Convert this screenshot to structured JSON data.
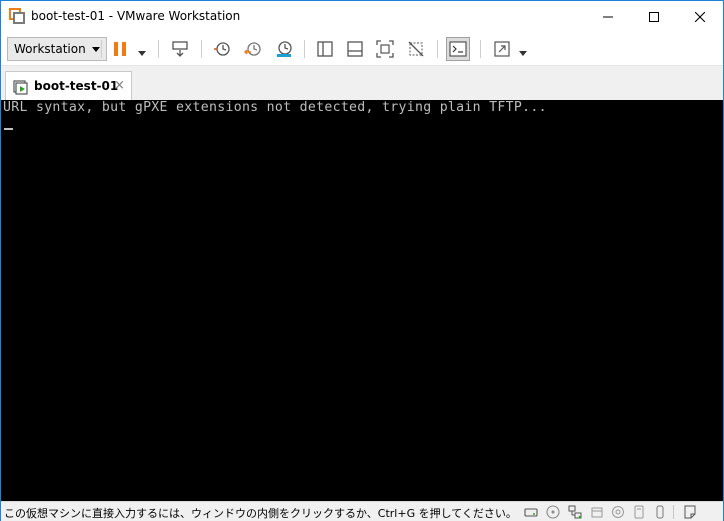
{
  "window": {
    "title": "boot-test-01 - VMware Workstation"
  },
  "toolbar": {
    "workstation_menu_label": "Workstation",
    "accent_color": "#f07c16"
  },
  "tabs": [
    {
      "label": "boot-test-01",
      "close_glyph": "×",
      "active": true
    }
  ],
  "console": {
    "lines": [
      "URL syntax, but gPXE extensions not detected, trying plain TFTP..."
    ]
  },
  "statusbar": {
    "hint_text": "この仮想マシンに直接入力するには、ウィンドウの内側をクリックするか、Ctrl+G を押してください。"
  }
}
